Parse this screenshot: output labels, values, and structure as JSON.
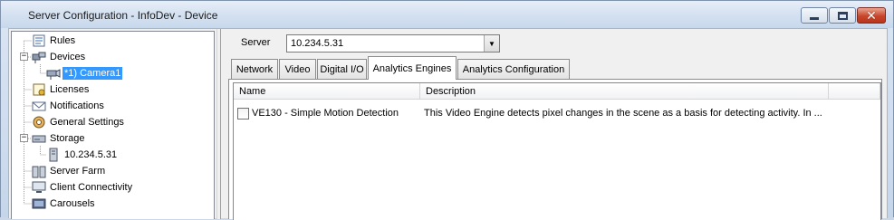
{
  "window": {
    "title": "Server Configuration - InfoDev - Device",
    "buttons": {
      "minimize": "minimize",
      "maximize": "maximize",
      "close": "✕"
    }
  },
  "tree": {
    "items": [
      {
        "label": "Rules",
        "icon": "rules-icon"
      },
      {
        "label": "Devices",
        "icon": "devices-icon"
      },
      {
        "label": "*1) Camera1",
        "icon": "camera-icon",
        "selected": true
      },
      {
        "label": "Licenses",
        "icon": "licenses-icon"
      },
      {
        "label": "Notifications",
        "icon": "notifications-icon"
      },
      {
        "label": "General Settings",
        "icon": "gear-icon"
      },
      {
        "label": "Storage",
        "icon": "storage-icon"
      },
      {
        "label": "10.234.5.31",
        "icon": "server-icon"
      },
      {
        "label": "Server Farm",
        "icon": "server-farm-icon"
      },
      {
        "label": "Client Connectivity",
        "icon": "client-icon"
      },
      {
        "label": "Carousels",
        "icon": "carousels-icon"
      }
    ]
  },
  "server": {
    "label": "Server",
    "value": "10.234.5.31"
  },
  "tabs": [
    {
      "label": "Network"
    },
    {
      "label": "Video"
    },
    {
      "label": "Digital I/O"
    },
    {
      "label": "Analytics Engines",
      "active": true
    },
    {
      "label": "Analytics Configuration"
    }
  ],
  "engines": {
    "columns": [
      "Name",
      "Description"
    ],
    "rows": [
      {
        "checked": false,
        "name": "VE130 - Simple Motion Detection",
        "description": "This Video Engine detects pixel changes in the scene as a basis for detecting activity. In ..."
      }
    ]
  },
  "colors": {
    "selection": "#3399ff",
    "titlebar": "#d3e0f0",
    "close_button": "#c8452a"
  }
}
